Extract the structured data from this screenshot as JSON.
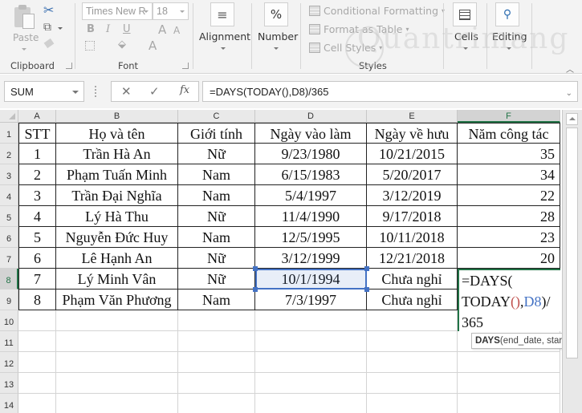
{
  "ribbon": {
    "clipboard": {
      "paste_label": "Paste",
      "group_label": "Clipboard",
      "icons": [
        "paste-icon",
        "cut-icon",
        "copy-icon",
        "format-painter-icon"
      ]
    },
    "font": {
      "font_name": "Times New R",
      "font_size": "18",
      "bold": "B",
      "italic": "I",
      "underline": "U",
      "grow": "A",
      "shrink": "A",
      "font_color": "A",
      "group_label": "Font"
    },
    "alignment": {
      "label": "Alignment",
      "icon_glyph": "≡"
    },
    "number": {
      "label": "Number",
      "icon_glyph": "%"
    },
    "styles": {
      "conditional_formatting": "Conditional Formatting",
      "format_as_table": "Format as Table",
      "cell_styles": "Cell Styles",
      "group_label": "Styles"
    },
    "cells": {
      "label": "Cells"
    },
    "editing": {
      "label": "Editing"
    },
    "watermark": "Quantrimang"
  },
  "formula_bar": {
    "name_box": "SUM",
    "cancel_glyph": "✕",
    "enter_glyph": "✓",
    "fx_label": "fx",
    "formula": "=DAYS(TODAY(),D8)/365"
  },
  "grid": {
    "columns": [
      "A",
      "B",
      "C",
      "D",
      "E",
      "F"
    ],
    "row_numbers": [
      "1",
      "2",
      "3",
      "4",
      "5",
      "6",
      "7",
      "8",
      "9",
      "10",
      "11",
      "12",
      "13",
      "14"
    ],
    "header": [
      "STT",
      "Họ và tên",
      "Giới tính",
      "Ngày vào làm",
      "Ngày về hưu",
      "Năm công tác"
    ],
    "rows": [
      [
        "1",
        "Trần Hà An",
        "Nữ",
        "9/23/1980",
        "10/21/2015",
        "35"
      ],
      [
        "2",
        "Phạm Tuấn Minh",
        "Nam",
        "6/15/1983",
        "5/20/2017",
        "34"
      ],
      [
        "3",
        "Trần Đại Nghĩa",
        "Nam",
        "5/4/1997",
        "3/12/2019",
        "22"
      ],
      [
        "4",
        "Lý Hà Thu",
        "Nữ",
        "11/4/1990",
        "9/17/2018",
        "28"
      ],
      [
        "5",
        "Nguyễn Đức Huy",
        "Nam",
        "12/5/1995",
        "10/11/2018",
        "23"
      ],
      [
        "6",
        "Lê Hạnh An",
        "Nữ",
        "3/12/1999",
        "12/21/2018",
        "20"
      ],
      [
        "7",
        "Lý Minh Vân",
        "Nữ",
        "10/1/1994",
        "Chưa nghỉ",
        ""
      ],
      [
        "8",
        "Phạm Văn Phương",
        "Nam",
        "7/3/1997",
        "Chưa nghỉ",
        ""
      ]
    ],
    "selected_column": "F",
    "selected_row": "8",
    "referenced_cell": "D8",
    "editing_cell": {
      "line1": "=DAYS(",
      "line2_a": "TODAY",
      "line2_paren": "()",
      "line2_comma": ",",
      "line2_ref": "D8",
      "line2_end": ")/",
      "line3": "365"
    },
    "tooltip": {
      "fn": "DAYS",
      "args": "(end_date, start_date)"
    }
  },
  "colors": {
    "accent_green": "#217346",
    "ref_blue": "#4472c4",
    "paren_red": "#c0504d"
  }
}
